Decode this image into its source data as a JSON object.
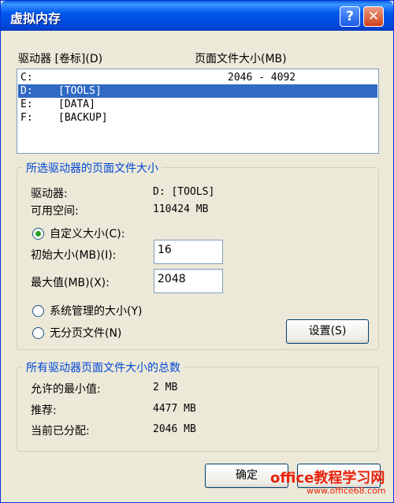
{
  "window": {
    "title": "虚拟内存",
    "help_glyph": "?",
    "close_glyph": "✕"
  },
  "drives_list": {
    "header_drive": "驱动器 [卷标](D)",
    "header_size": "页面文件大小(MB)",
    "rows": [
      {
        "drive": "C:",
        "label": "",
        "size": "2046 - 4092",
        "selected": false
      },
      {
        "drive": "D:",
        "label": "[TOOLS]",
        "size": "",
        "selected": true
      },
      {
        "drive": "E:",
        "label": "[DATA]",
        "size": "",
        "selected": false
      },
      {
        "drive": "F:",
        "label": "[BACKUP]",
        "size": "",
        "selected": false
      }
    ]
  },
  "selected_drive_group": {
    "title": "所选驱动器的页面文件大小",
    "drive_label": "驱动器:",
    "drive_value": "D:  [TOOLS]",
    "space_label": "可用空间:",
    "space_value": "110424 MB",
    "custom_size_label": "自定义大小(C):",
    "initial_size_label": "初始大小(MB)(I):",
    "initial_size_value": "16",
    "max_size_label": "最大值(MB)(X):",
    "max_size_value": "2048",
    "system_managed_label": "系统管理的大小(Y)",
    "no_paging_label": "无分页文件(N)",
    "set_button": "设置(S)",
    "selected_option": "custom"
  },
  "totals_group": {
    "title": "所有驱动器页面文件大小的总数",
    "min_label": "允许的最小值:",
    "min_value": "2 MB",
    "recommended_label": "推荐:",
    "recommended_value": "4477 MB",
    "current_label": "当前已分配:",
    "current_value": "2046 MB"
  },
  "footer": {
    "ok_button": "确定"
  },
  "watermark": {
    "text": "office教程学习网",
    "url": "www.office68.com"
  },
  "colors": {
    "titlebar": "#0058ee",
    "selection": "#316ac5",
    "group_title": "#0046d5",
    "watermark": "#e8230c"
  }
}
